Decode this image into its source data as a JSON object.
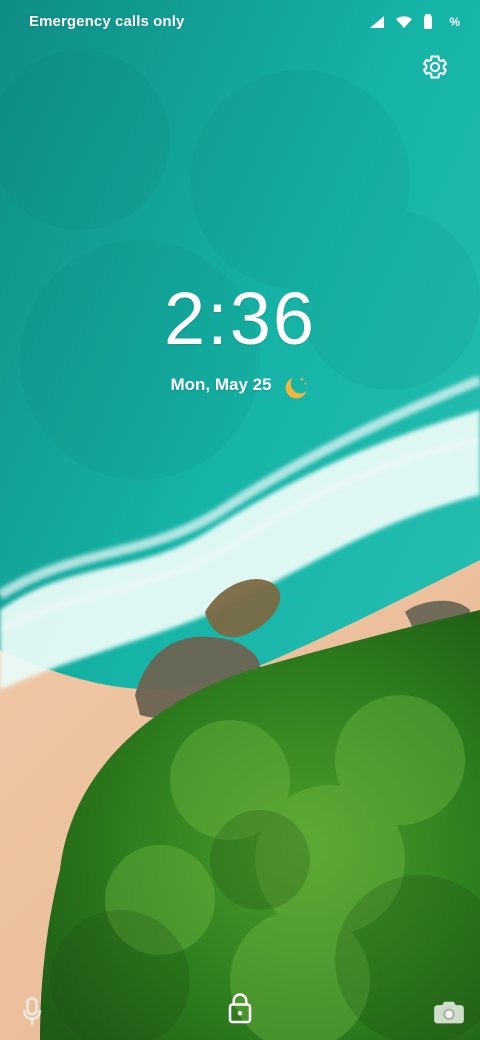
{
  "status_bar": {
    "carrier_text": "Emergency calls only",
    "battery_text": "%",
    "icons": [
      "signal-icon",
      "wifi-icon",
      "battery-icon"
    ]
  },
  "lock_screen": {
    "time": "2:36",
    "date": "Mon, May 25",
    "weather_icon": "moon-stars-icon",
    "accent_color": "#f2b63c"
  },
  "buttons": {
    "settings_icon": "gear-icon",
    "voice_icon": "microphone-icon",
    "lock_icon": "lock-icon",
    "camera_icon": "camera-icon"
  }
}
